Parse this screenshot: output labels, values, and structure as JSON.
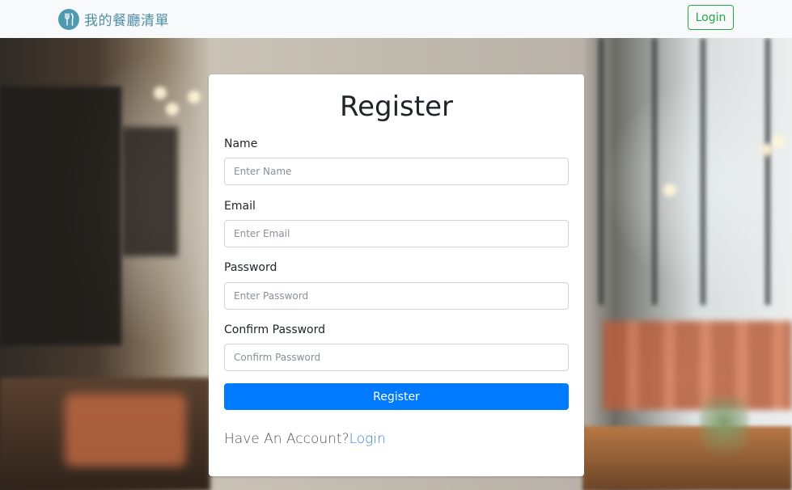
{
  "navbar": {
    "brand_text": "我的餐廳清單",
    "brand_icon": "utensils-icon",
    "login_label": "Login",
    "colors": {
      "brand": "#4f8fa8",
      "login": "#28a745",
      "bg": "#f8f9fa"
    }
  },
  "form": {
    "title": "Register",
    "fields": [
      {
        "label": "Name",
        "placeholder": "Enter Name",
        "value": ""
      },
      {
        "label": "Email",
        "placeholder": "Enter Email",
        "value": ""
      },
      {
        "label": "Password",
        "placeholder": "Enter Password",
        "value": ""
      },
      {
        "label": "Confirm Password",
        "placeholder": "Confirm Password",
        "value": ""
      }
    ],
    "submit_label": "Register",
    "have_account_text": "Have An Account?",
    "login_link": "Login",
    "colors": {
      "primary": "#007bff",
      "link": "#3b82d6"
    }
  }
}
